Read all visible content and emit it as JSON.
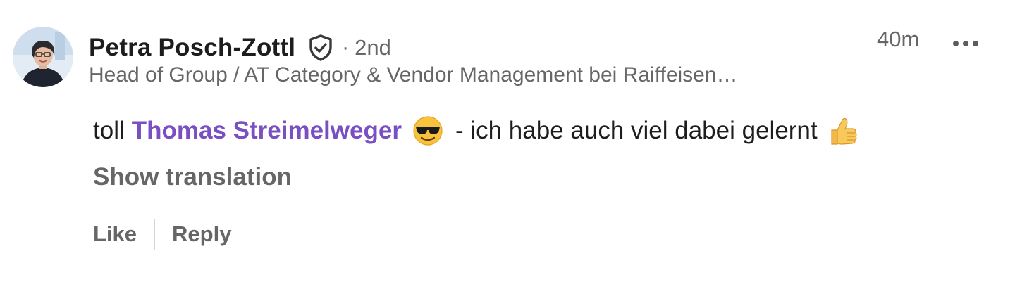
{
  "comment": {
    "author": {
      "name": "Petra Posch-Zottl",
      "verified_icon": "shield-check-icon",
      "connection_separator": "·",
      "connection_degree": "2nd",
      "headline": "Head of Group / AT Category & Vendor Management bei Raiffeisen…"
    },
    "timestamp": "40m",
    "more_icon": "more-horizontal-icon",
    "body": {
      "before_mention": "toll",
      "mention": "Thomas Streimelweger",
      "emoji_1": "smiling-face-with-sunglasses",
      "after_mention": "- ich habe auch viel dabei gelernt",
      "emoji_2": "thumbs-up"
    },
    "show_translation_label": "Show translation",
    "actions": {
      "like_label": "Like",
      "reply_label": "Reply"
    }
  },
  "colors": {
    "text_primary": "#1d1d1f",
    "text_secondary": "#666666",
    "mention": "#7a4fc2",
    "divider": "#d6d6d6",
    "background": "#ffffff"
  }
}
